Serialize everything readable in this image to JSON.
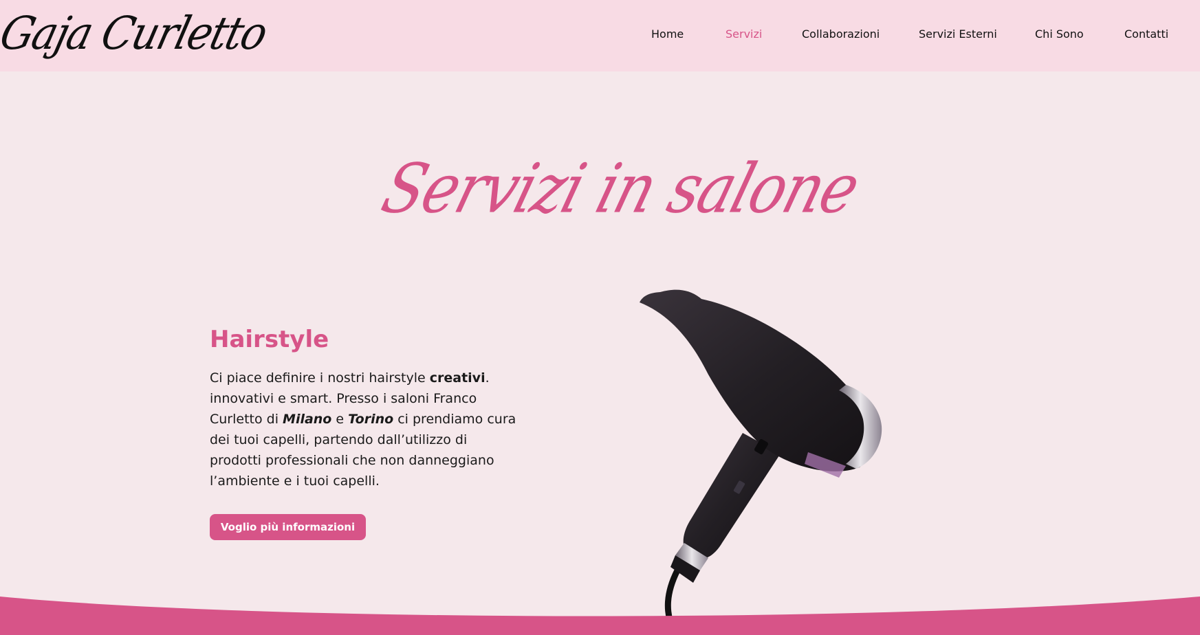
{
  "header": {
    "logo_text": "Gaja Curletto",
    "nav": [
      "Home",
      "Servizi",
      "Collaborazioni",
      "Servizi Esterni",
      "Chi Sono",
      "Contatti"
    ],
    "active_item": "Servizi"
  },
  "hero": {
    "title": "Servizi in salone"
  },
  "service": {
    "title": "Hairstyle",
    "description": {
      "p1": "Ci piace definire i nostri hairstyle ",
      "b1": "creativi",
      "p2": ". innovativi e smart. Presso i saloni Franco Curletto di ",
      "b2": "Milano",
      "p3": " e ",
      "b3": "Torino",
      "p4": " ci prendiamo cura dei tuoi capelli, partendo dall’utilizzo di prodotti professionali che non danneggiano l’ambiente e i tuoi capelli."
    },
    "cta_label": "Voglio più informazioni",
    "image_icon": "hair-dryer-icon"
  },
  "colors": {
    "accent": "#d75488",
    "header_bg": "#f8dbe4",
    "page_bg": "#f5e8eb"
  }
}
